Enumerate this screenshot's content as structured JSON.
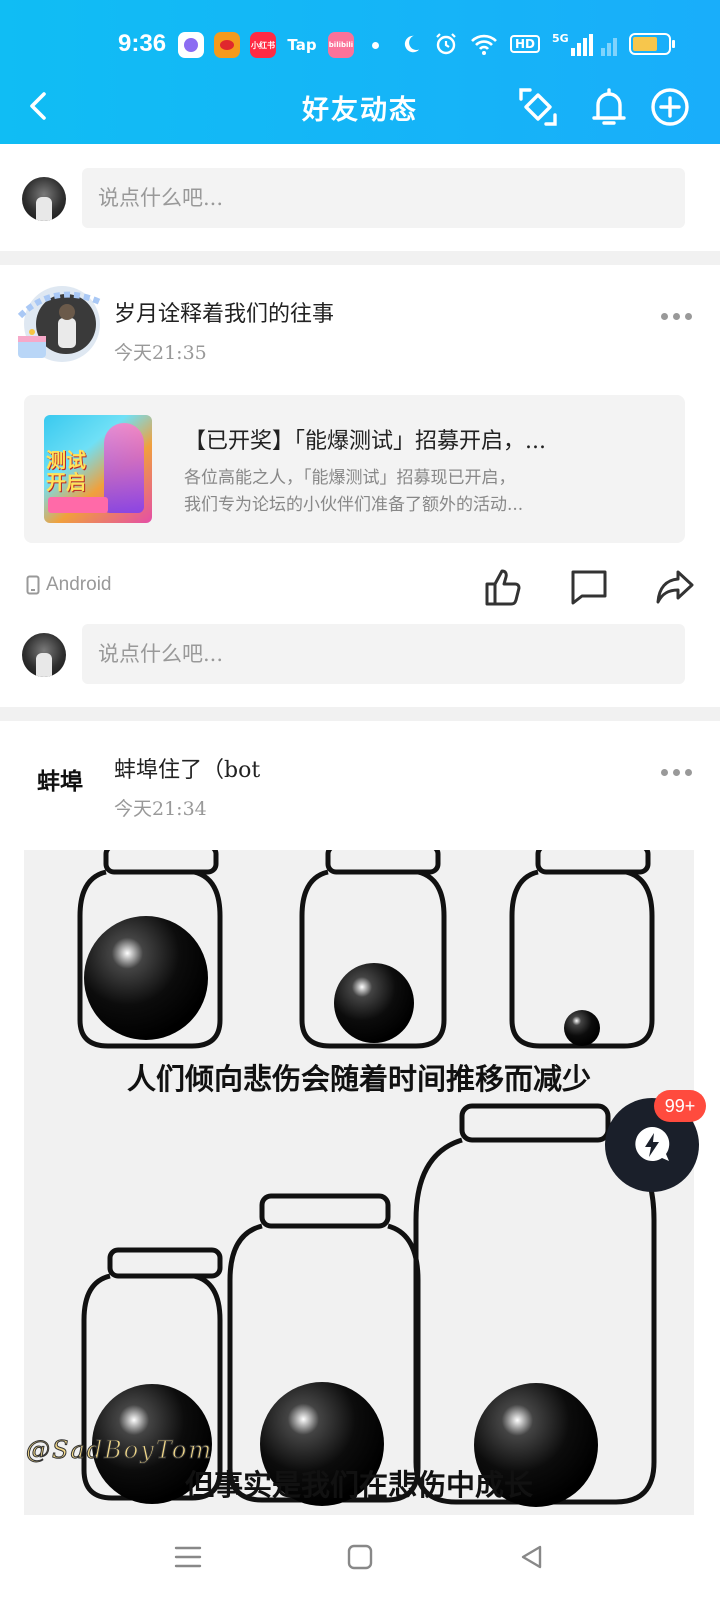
{
  "status_bar": {
    "time": "9:36",
    "apps": [
      {
        "icon": "moon-app-icon",
        "label": "",
        "color": "#8c6cf2"
      },
      {
        "icon": "weibo-icon",
        "label": "",
        "color": "#f49a1b"
      },
      {
        "icon": "xiaohongshu-icon",
        "label": "小红书",
        "color": "#ff2b43"
      },
      {
        "label": "Tap",
        "icon": "taptap-icon",
        "color": "transparent"
      },
      {
        "icon": "bilibili-icon",
        "label": "bilibili",
        "color": "#fb7299"
      }
    ],
    "network": "5G",
    "hd": "HD",
    "battery_level": 0.7
  },
  "header": {
    "title": "好友动态",
    "background": "#16b4f6"
  },
  "composer": {
    "placeholder": "说点什么吧..."
  },
  "posts": [
    {
      "author": "岁月诠释着我们的往事",
      "time": "今天21:35",
      "share": {
        "title": "【已开奖】「能爆测试」招募开启，...",
        "desc_line1": "各位高能之人，「能爆测试」招募现已开启，",
        "desc_line2": "我们专为论坛的小伙伴们准备了额外的活动...",
        "thumb_text": "测试开启"
      },
      "device": "Android"
    },
    {
      "author_avatar_text": "蚌埠",
      "author": "蚌埠住了（bot",
      "time": "今天21:34",
      "image": {
        "caption_top": "人们倾向悲伤会随着时间推移而减少",
        "caption_bottom": "但事实是我们在悲伤中成长",
        "watermark": "@SadBoyTom"
      }
    }
  ],
  "fab": {
    "badge": "99+"
  }
}
